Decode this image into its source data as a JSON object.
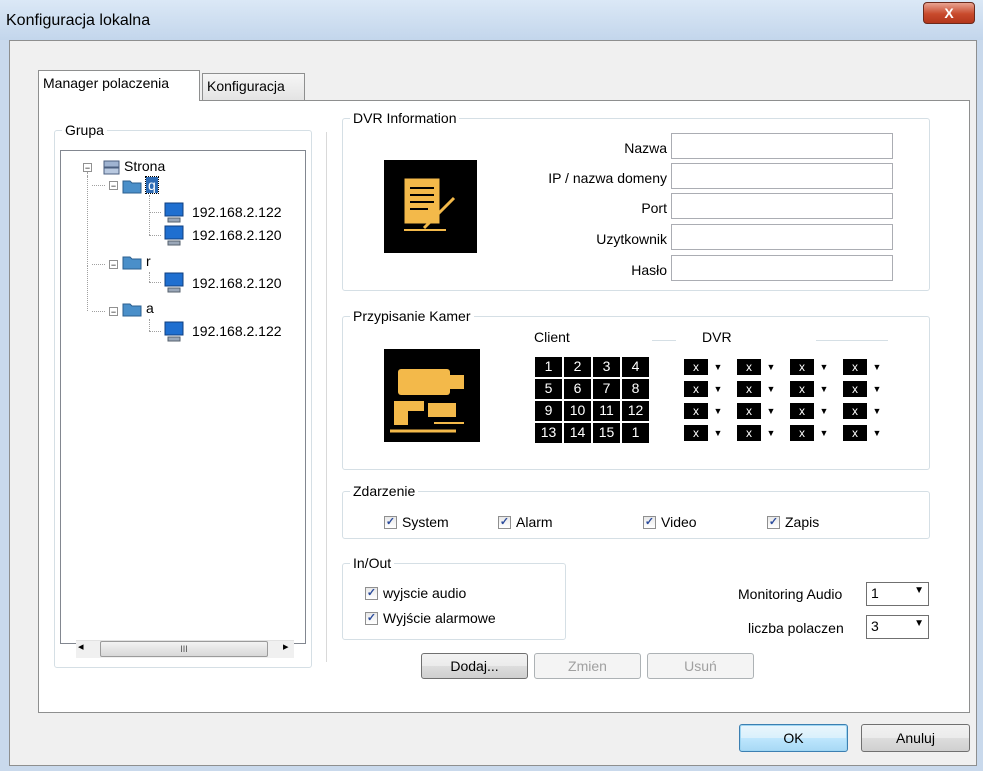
{
  "window": {
    "title": "Konfiguracja lokalna",
    "close_label": "X"
  },
  "tabs": [
    {
      "label": "Manager polaczenia"
    },
    {
      "label": "Konfiguracja"
    }
  ],
  "group_panel": {
    "legend": "Grupa",
    "tree": {
      "root": "Strona",
      "groups": [
        {
          "name": "q",
          "items": [
            "192.168.2.122",
            "192.168.2.120"
          ]
        },
        {
          "name": "r",
          "items": [
            "192.168.2.120"
          ]
        },
        {
          "name": "a",
          "items": [
            "192.168.2.122"
          ]
        }
      ]
    },
    "scrollbar": {
      "left": "◂",
      "thumb": "III",
      "right": "▸"
    }
  },
  "dvr_info": {
    "legend": "DVR Information",
    "fields": [
      {
        "label": "Nazwa",
        "value": ""
      },
      {
        "label": "IP / nazwa domeny",
        "value": ""
      },
      {
        "label": "Port",
        "value": ""
      },
      {
        "label": "Uzytkownik",
        "value": ""
      },
      {
        "label": "Hasło",
        "value": ""
      }
    ]
  },
  "camera": {
    "legend": "Przypisanie Kamer",
    "client_label": "Client",
    "dvr_label": "DVR",
    "client_grid": [
      [
        "1",
        "2",
        "3",
        "4"
      ],
      [
        "5",
        "6",
        "7",
        "8"
      ],
      [
        "9",
        "10",
        "11",
        "12"
      ],
      [
        "13",
        "14",
        "15",
        "1"
      ]
    ],
    "dvr_value": "x",
    "dvr_arrow": "▼"
  },
  "event": {
    "legend": "Zdarzenie",
    "items": [
      {
        "label": "System",
        "checked": true
      },
      {
        "label": "Alarm",
        "checked": true
      },
      {
        "label": "Video",
        "checked": true
      },
      {
        "label": "Zapis",
        "checked": true
      }
    ]
  },
  "inout": {
    "legend": "In/Out",
    "items": [
      {
        "label": "wyjscie audio",
        "checked": true
      },
      {
        "label": "Wyjście alarmowe",
        "checked": true
      }
    ],
    "check_mark": "✓"
  },
  "monitoring": {
    "label": "Monitoring Audio",
    "value": "1"
  },
  "connections": {
    "label": "liczba polaczen",
    "value": "3"
  },
  "select_arrow": "▼",
  "actions": {
    "add": "Dodaj...",
    "change": "Zmien",
    "delete": "Usuń"
  },
  "footer": {
    "ok": "OK",
    "cancel": "Anuluj"
  }
}
